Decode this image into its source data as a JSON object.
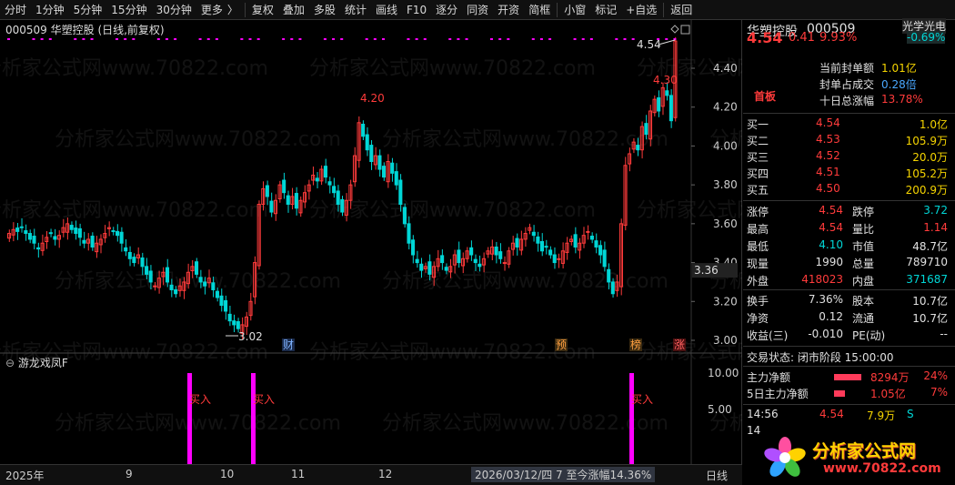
{
  "toolbar": {
    "items": [
      "分时",
      "1分钟",
      "5分钟",
      "15分钟",
      "30分钟",
      "更多",
      "复权",
      "叠加",
      "多股",
      "统计",
      "画线",
      "F10",
      "逐分",
      "同资",
      "开资",
      "简框",
      "小窗",
      "标记",
      "+自选",
      "返回"
    ],
    "more_arrow": "〉"
  },
  "main": {
    "title": "000509 华塑控股 (日线,前复权)",
    "price_axis": [
      "4.40",
      "4.20",
      "4.00",
      "3.80",
      "3.60",
      "3.40",
      "3.20",
      "3.00"
    ],
    "current_price_tag": "3.36",
    "annotations": {
      "high_420": "4.20",
      "high_430": "4.30",
      "last_454": "4.54",
      "low_302": "3.02"
    },
    "event_marks": [
      "财",
      "预",
      "榜",
      "涨"
    ]
  },
  "indicator": {
    "title": "游龙戏凤F",
    "axis": [
      "10.00",
      "5.00"
    ],
    "signal_label": "买入"
  },
  "bottom": {
    "labels": [
      "2025年",
      "9",
      "10",
      "11",
      "12"
    ],
    "status": "2026/03/12/四 7 至今涨幅14.36%",
    "period": "日线"
  },
  "quote": {
    "name": "华塑控股",
    "code": "000509",
    "sector": "光学光电",
    "sector_change": "-0.69%",
    "price": "4.54",
    "change": "0.41",
    "change_pct": "9.93%",
    "board_label": "首板",
    "seal_label": "当前封单额",
    "seal_value": "1.01亿",
    "seal_ratio_label": "封单占成交",
    "seal_ratio_value": "0.28倍",
    "ten_day_label": "十日总涨幅",
    "ten_day_value": "13.78%",
    "bids": [
      {
        "label": "买一",
        "price": "4.54",
        "vol": "1.0亿"
      },
      {
        "label": "买二",
        "price": "4.53",
        "vol": "105.9万"
      },
      {
        "label": "买三",
        "price": "4.52",
        "vol": "20.0万"
      },
      {
        "label": "买四",
        "price": "4.51",
        "vol": "105.2万"
      },
      {
        "label": "买五",
        "price": "4.50",
        "vol": "200.9万"
      }
    ],
    "stats": [
      {
        "l1": "涨停",
        "v1": "4.54",
        "l2": "跌停",
        "v2": "3.72"
      },
      {
        "l1": "最高",
        "v1": "4.54",
        "l2": "量比",
        "v2": "1.14"
      },
      {
        "l1": "最低",
        "v1": "4.10",
        "l2": "市值",
        "v2": "48.7亿"
      },
      {
        "l1": "现量",
        "v1": "1990",
        "l2": "总量",
        "v2": "789710"
      },
      {
        "l1": "外盘",
        "v1": "418023",
        "l2": "内盘",
        "v2": "371687"
      }
    ],
    "stats2": [
      {
        "l1": "换手",
        "v1": "7.36%",
        "l2": "股本",
        "v2": "10.7亿"
      },
      {
        "l1": "净资",
        "v1": "0.12",
        "l2": "流通",
        "v2": "10.7亿"
      },
      {
        "l1": "收益(三)",
        "v1": "-0.010",
        "l2": "PE(动)",
        "v2": "--"
      }
    ],
    "trade_status": "交易状态: 闭市阶段 15:00:00",
    "main_flow_label": "主力净额",
    "main_flow_value": "8294万",
    "main_flow_pct": "24%",
    "five_flow_label": "5日主力净额",
    "five_flow_value": "1.05亿",
    "five_flow_pct": "7%",
    "tick_time": "14:56",
    "tick_price": "4.54",
    "tick_vol": "7.9万",
    "tick_side": "S",
    "tick_time_2": "14"
  },
  "logo": {
    "cn": "分析家公式网",
    "url": "www.70822.com"
  },
  "watermark": "分析家公式网www.70822.com",
  "colors": {
    "up": "#ff3b3b",
    "down": "#00d6d6",
    "signal": "#ff00ff",
    "bg": "#000000"
  }
}
